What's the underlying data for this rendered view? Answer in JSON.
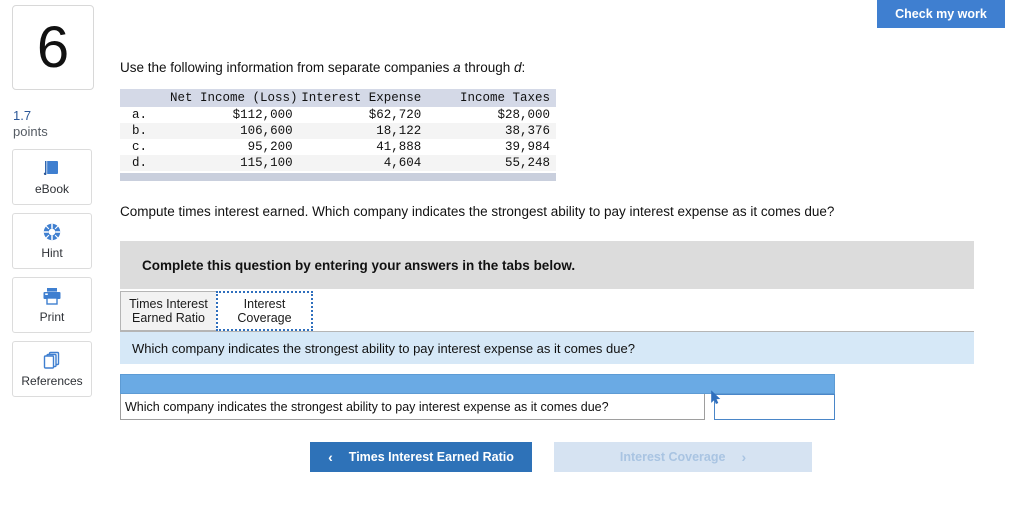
{
  "header": {
    "check_my_work_label": "Check my work"
  },
  "sidebar": {
    "question_number": "6",
    "points_value": "1.7",
    "points_label": "points",
    "tools": [
      {
        "label": "eBook",
        "icon": "book-icon"
      },
      {
        "label": "Hint",
        "icon": "lifebuoy-icon"
      },
      {
        "label": "Print",
        "icon": "printer-icon"
      },
      {
        "label": "References",
        "icon": "copy-stack-icon"
      }
    ]
  },
  "main": {
    "intro_prefix": "Use the following information from separate companies ",
    "intro_italic_a": "a",
    "intro_mid": " through ",
    "intro_italic_d": "d",
    "intro_suffix": ":",
    "compute_text": "Compute times interest earned. Which company indicates the strongest ability to pay interest expense as it comes due?",
    "instruction_banner": "Complete this question by entering your answers in the tabs below.",
    "question_banner": "Which company indicates the strongest ability to pay interest expense as it comes due?"
  },
  "data_table": {
    "columns": [
      "",
      "Net Income (Loss)",
      "Interest Expense",
      "Income Taxes"
    ],
    "rows": [
      {
        "label": "a.",
        "net_income": "$112,000",
        "interest_expense": "$62,720",
        "income_taxes": "$28,000"
      },
      {
        "label": "b.",
        "net_income": "106,600",
        "interest_expense": "18,122",
        "income_taxes": "38,376"
      },
      {
        "label": "c.",
        "net_income": "95,200",
        "interest_expense": "41,888",
        "income_taxes": "39,984"
      },
      {
        "label": "d.",
        "net_income": "115,100",
        "interest_expense": "4,604",
        "income_taxes": "55,248"
      }
    ]
  },
  "tabs": [
    {
      "label_line1": "Times Interest",
      "label_line2": "Earned Ratio",
      "active": false
    },
    {
      "label_line1": "Interest",
      "label_line2": "Coverage",
      "active": true
    }
  ],
  "answer_grid": {
    "row_label": "Which company indicates the strongest ability to pay interest expense as it comes due?",
    "input_value": "",
    "input_placeholder": ""
  },
  "bottom_nav": {
    "prev_label": "Times Interest Earned Ratio",
    "prev_chevron": "‹",
    "next_label": "Interest Coverage",
    "next_chevron": "›"
  },
  "colors": {
    "brand_blue": "#3f7fd0",
    "nav_blue": "#2e72b8",
    "grid_header_blue": "#6aaae4",
    "banner_light_blue": "#d6e8f7",
    "table_header_grey": "#d4d9e7",
    "instruction_grey": "#dcdcdc"
  }
}
